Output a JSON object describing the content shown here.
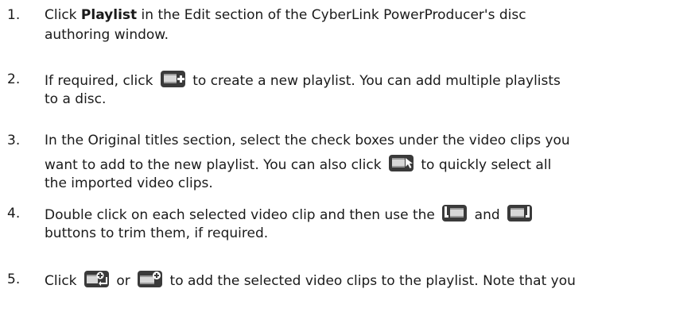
{
  "steps": [
    {
      "number": "1.",
      "line1": {
        "pre": "Click ",
        "bold": "Playlist",
        "post": " in the Edit section of the CyberLink PowerProducer's disc"
      },
      "line2": "authoring window."
    },
    {
      "number": "2.",
      "line1": {
        "pre": "If required, click ",
        "post": " to create a new playlist. You can add multiple playlists"
      },
      "line2": "to a disc.",
      "icons": [
        "new-playlist-icon"
      ]
    },
    {
      "number": "3.",
      "line1": "In the Original titles section, select the check boxes under the video clips you",
      "line2": {
        "pre": "want to add to the new playlist. You can also click ",
        "post": " to quickly select all"
      },
      "line3": "the imported video clips.",
      "icons": [
        "select-all-clips-icon"
      ]
    },
    {
      "number": "4.",
      "line1": {
        "pre": "Double click on each selected video clip and then use the ",
        "mid": " and ",
        "post": ""
      },
      "line2": "buttons to trim them, if required.",
      "icons": [
        "mark-in-icon",
        "mark-out-icon"
      ]
    },
    {
      "number": "5.",
      "line1": {
        "pre": "Click ",
        "mid": " or ",
        "post": " to add the selected video clips to the playlist. Note that you"
      },
      "icons": [
        "insert-clip-icon",
        "append-clip-icon"
      ]
    }
  ],
  "colors": {
    "text": "#1a1a1a",
    "icon_dark": "#3a3a3a",
    "icon_light": "#d8d8d8"
  }
}
